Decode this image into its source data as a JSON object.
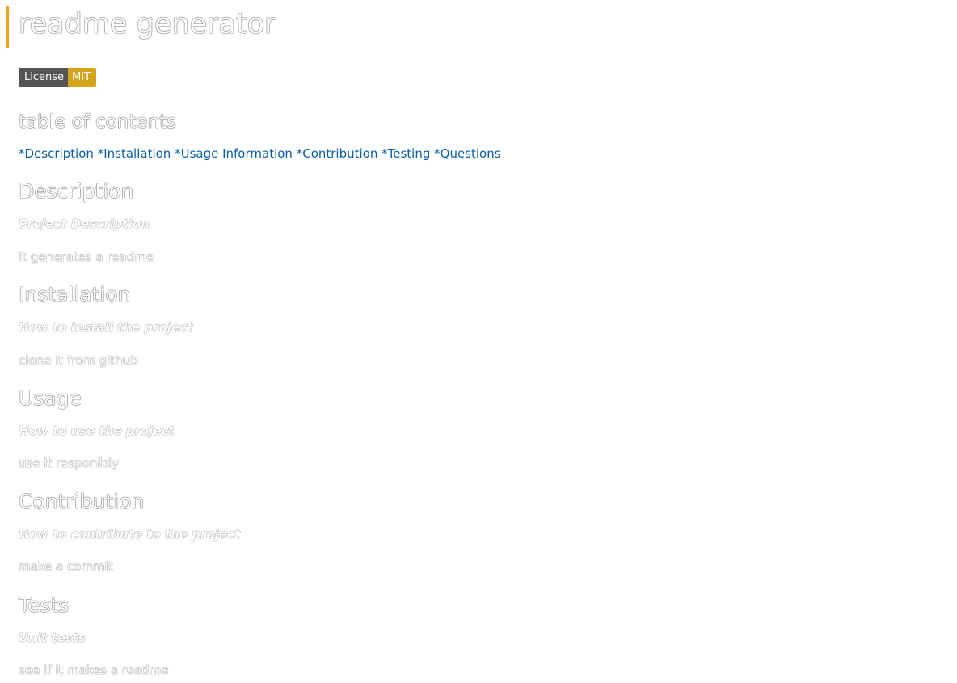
{
  "title": "readme generator",
  "badge": {
    "label": "License",
    "value": "MIT"
  },
  "toc": {
    "heading": "table of contents",
    "links": [
      "*Description",
      "*Installation",
      "*Usage Information",
      "*Contribution",
      "*Testing",
      "*Questions"
    ]
  },
  "sections": [
    {
      "heading": "Description",
      "subheading": "Project Description",
      "body": "it generates a readme"
    },
    {
      "heading": "Installation",
      "subheading": "How to install the project",
      "body": "clone it from github"
    },
    {
      "heading": "Usage",
      "subheading": "How to use the project",
      "body": "use it responibly"
    },
    {
      "heading": "Contribution",
      "subheading": "How to contribute to the project",
      "body": "make a commit"
    },
    {
      "heading": "Tests",
      "subheading": "Unit tests",
      "body": "see if it makes a readme"
    }
  ],
  "colors": {
    "accent_border": "#f0a020",
    "badge_left": "#555555",
    "badge_right": "#d4a51a",
    "link": "#0b5fa5"
  }
}
